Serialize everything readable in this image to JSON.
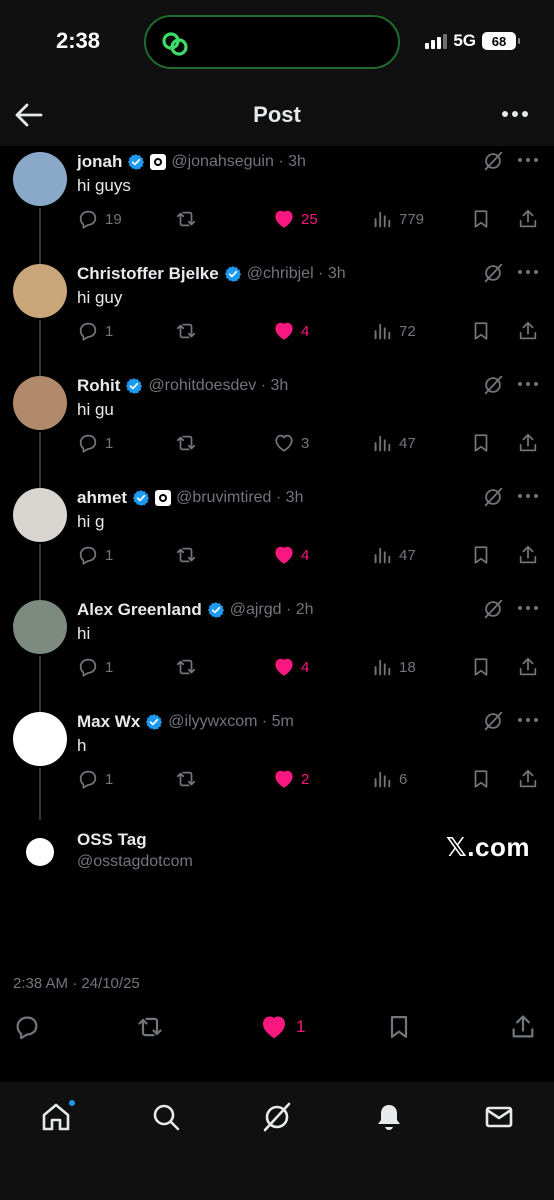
{
  "status_bar": {
    "time": "2:38",
    "network": "5G",
    "battery": "68"
  },
  "header": {
    "title": "Post"
  },
  "thread": [
    {
      "name": "jonah",
      "handle": "@jonahseguin · 3h",
      "affiliate_badge": true,
      "text": "hi guys",
      "replies": "19",
      "likes": "25",
      "liked": true,
      "views": "779",
      "avatar_bg": "#8aa8c8"
    },
    {
      "name": "Christoffer Bjelke",
      "handle": "@chribjel · 3h",
      "affiliate_badge": false,
      "text": "hi guy",
      "replies": "1",
      "likes": "4",
      "liked": true,
      "views": "72",
      "avatar_bg": "#c9a57a"
    },
    {
      "name": "Rohit",
      "handle": "@rohitdoesdev · 3h",
      "affiliate_badge": false,
      "text": "hi gu",
      "replies": "1",
      "likes": "3",
      "liked": false,
      "views": "47",
      "avatar_bg": "#b08a6a"
    },
    {
      "name": "ahmet",
      "handle": "@bruvimtired · 3h",
      "affiliate_badge": true,
      "text": "hi g",
      "replies": "1",
      "likes": "4",
      "liked": true,
      "views": "47",
      "avatar_bg": "#d8d4cf"
    },
    {
      "name": "Alex Greenland",
      "handle": "@ajrgd · 2h",
      "affiliate_badge": false,
      "text": "hi",
      "replies": "1",
      "likes": "4",
      "liked": true,
      "views": "18",
      "avatar_bg": "#7d8a80"
    },
    {
      "name": "Max Wx",
      "handle": "@ilyywxcom · 5m",
      "affiliate_badge": false,
      "text": "h",
      "replies": "1",
      "likes": "2",
      "liked": true,
      "views": "6",
      "avatar_bg": "#ffffff"
    }
  ],
  "quote": {
    "name": "OSS Tag",
    "handle": "@osstagdotcom",
    "site": "𝕏.com"
  },
  "timestamp": "2:38 AM · 24/10/25",
  "main_actions": {
    "likes": "1"
  },
  "colors": {
    "like": "#f91880",
    "verified": "#1d9bf0",
    "muted": "#71767b"
  }
}
